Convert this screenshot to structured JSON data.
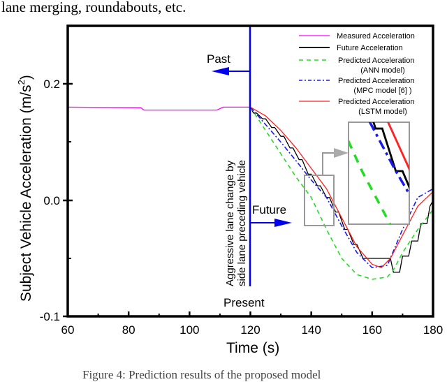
{
  "header_text": "lane merging, roundabouts, etc.",
  "caption": "Figure 4: Prediction results of the proposed model",
  "chart_data": {
    "type": "line",
    "title": "",
    "xlabel": "Time (s)",
    "ylabel": "Subject Vehicle Acceleration (m/s²)",
    "xlim": [
      60,
      180
    ],
    "ylim": [
      -0.1,
      0.25
    ],
    "xticks": [
      60,
      80,
      100,
      120,
      140,
      160,
      180
    ],
    "xtick_labels": [
      "60",
      "80",
      "100",
      "120",
      "140",
      "160",
      "180"
    ],
    "yticks": [
      0.2,
      0.0,
      -0.1
    ],
    "ytick_labels": [
      "0.2",
      "0.0",
      "-0.1"
    ],
    "grid": false,
    "legend_position": "top-right",
    "series": [
      {
        "name": "Measured Acceleration",
        "color": "#ff00ff",
        "style": "solid",
        "x": [
          60,
          84,
          85,
          109,
          111,
          120
        ],
        "y": [
          0.16,
          0.159,
          0.155,
          0.155,
          0.16,
          0.16
        ]
      },
      {
        "name": "Future Acceleration",
        "color": "#000000",
        "style": "step",
        "x": [
          120,
          121,
          122,
          124,
          125,
          127,
          128,
          130,
          131,
          133,
          134,
          136,
          137,
          139,
          140,
          142,
          143,
          145,
          146,
          148,
          149,
          151,
          152,
          154,
          155,
          157,
          158,
          166,
          167,
          169,
          170,
          172,
          173,
          175,
          176,
          178,
          179,
          180
        ],
        "y": [
          0.16,
          0.15,
          0.15,
          0.14,
          0.14,
          0.125,
          0.125,
          0.11,
          0.11,
          0.09,
          0.09,
          0.07,
          0.07,
          0.045,
          0.045,
          0.025,
          0.025,
          0.005,
          0.005,
          -0.01,
          -0.01,
          -0.025,
          -0.025,
          -0.038,
          -0.038,
          -0.05,
          -0.05,
          -0.05,
          -0.062,
          -0.062,
          -0.048,
          -0.048,
          -0.035,
          -0.035,
          -0.02,
          -0.02,
          -0.005,
          0.0
        ]
      },
      {
        "name": "Predicted Acceleration (ANN model)",
        "color": "#22dd22",
        "style": "dashed",
        "x": [
          120,
          125,
          130,
          135,
          140,
          145,
          150,
          155,
          160,
          165,
          167,
          170,
          175,
          180
        ],
        "y": [
          0.16,
          0.12,
          0.08,
          0.04,
          0.005,
          -0.025,
          -0.05,
          -0.064,
          -0.068,
          -0.066,
          -0.06,
          -0.045,
          -0.025,
          -0.008
        ]
      },
      {
        "name": "Predicted Acceleration (MPC model [6] )",
        "color": "#1a1aee",
        "style": "dashdot",
        "x": [
          120,
          125,
          130,
          135,
          140,
          145,
          150,
          155,
          160,
          165,
          170,
          175,
          180
        ],
        "y": [
          0.16,
          0.13,
          0.1,
          0.068,
          0.035,
          0.005,
          -0.022,
          -0.045,
          -0.058,
          -0.056,
          -0.025,
          0.005,
          0.02
        ]
      },
      {
        "name": "Predicted Acceleration (LSTM model)",
        "color": "#ff2020",
        "style": "solid",
        "x": [
          120,
          125,
          130,
          135,
          140,
          145,
          150,
          155,
          160,
          163,
          166,
          170,
          175,
          180
        ],
        "y": [
          0.16,
          0.145,
          0.12,
          0.09,
          0.055,
          0.02,
          -0.015,
          -0.04,
          -0.055,
          -0.058,
          -0.05,
          -0.03,
          -0.005,
          0.015
        ]
      }
    ],
    "annotations": [
      {
        "text": "Past",
        "x": 120,
        "arrow": "left",
        "color": "#0000ee"
      },
      {
        "text": "Future",
        "x": 120,
        "arrow": "right",
        "color": "#0000ee"
      },
      {
        "text": "Present",
        "x": 120
      },
      {
        "text": "Aggressive lane change by side lane preceding vehicle",
        "orientation": "vertical",
        "x": 120
      },
      {
        "text": "zoomed inset",
        "region_x": [
          138,
          147
        ],
        "region_y": [
          -0.02,
          0.025
        ]
      }
    ]
  },
  "legend": [
    {
      "line1": "Measured Acceleration",
      "line2": ""
    },
    {
      "line1": "Future Acceleration",
      "line2": ""
    },
    {
      "line1": "Predicted Acceleration",
      "line2": "(ANN model)"
    },
    {
      "line1": "Predicted Acceleration",
      "line2": "(MPC model [6] )"
    },
    {
      "line1": "Predicted Acceleration",
      "line2": "(LSTM model)"
    }
  ],
  "labels": {
    "past": "Past",
    "future": "Future",
    "present": "Present",
    "event_line1": "Aggressive lane change by",
    "event_line2": "side lane preceding vehicle",
    "ylabel_main": "Subject Vehicle Acceleration (m/s",
    "ylabel_sup": "2",
    "ylabel_end": ")",
    "xlabel": "Time (s)"
  }
}
